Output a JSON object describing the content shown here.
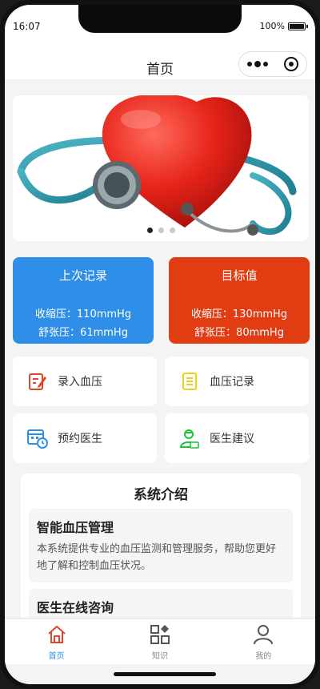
{
  "status": {
    "time": "16:07",
    "battery": "100%"
  },
  "nav": {
    "title": "首页"
  },
  "banner": {
    "dots": 3,
    "active_dot": 0
  },
  "last_record": {
    "title": "上次记录",
    "systolic": "收缩压：110mmHg",
    "diastolic": "舒张压：61mmHg"
  },
  "target": {
    "title": "目标值",
    "systolic": "收缩压：130mmHg",
    "diastolic": "舒张压：80mmHg"
  },
  "menu": {
    "input_bp": "录入血压",
    "bp_records": "血压记录",
    "book_doctor": "预约医生",
    "doctor_advice": "医生建议"
  },
  "intro": {
    "title": "系统介绍",
    "features": [
      {
        "title": "智能血压管理",
        "text": "本系统提供专业的血压监测和管理服务，帮助您更好地了解和控制血压状况。"
      },
      {
        "title": "医生在线咨询",
        "text": ""
      }
    ]
  },
  "tabs": [
    {
      "label": "首页",
      "active": true
    },
    {
      "label": "知识",
      "active": false
    },
    {
      "label": "我的",
      "active": false
    }
  ],
  "colors": {
    "accent_blue": "#2f8fe8",
    "accent_red": "#e23c12",
    "tab_active": "#2f8fe8"
  }
}
